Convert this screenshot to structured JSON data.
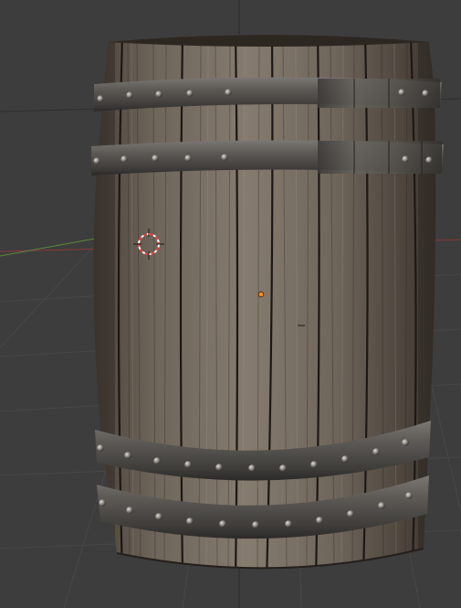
{
  "app": {
    "window": "3D Viewport",
    "mode": "perspective"
  },
  "scene": {
    "object": "wooden-barrel",
    "material": "weathered-wood-planks",
    "hoops": [
      {
        "name": "top-hoop-upper"
      },
      {
        "name": "top-hoop-lower"
      },
      {
        "name": "bottom-hoop-upper"
      },
      {
        "name": "bottom-hoop-lower"
      }
    ],
    "has_3d_cursor": true,
    "has_origin_dot": true
  },
  "colors": {
    "background": "#3d3d3d",
    "grid_line": "#4a4a4a",
    "x_axis": "#9a3a3a",
    "y_axis": "#5a8a3a",
    "wood_light": "#8a7f72",
    "wood_dark": "#4a4037",
    "metal": "#5a5855",
    "rivet": "#bdb8b0",
    "origin_dot": "#ff8a1a",
    "cursor_red": "#e8403a",
    "cursor_white": "#ffffff"
  }
}
